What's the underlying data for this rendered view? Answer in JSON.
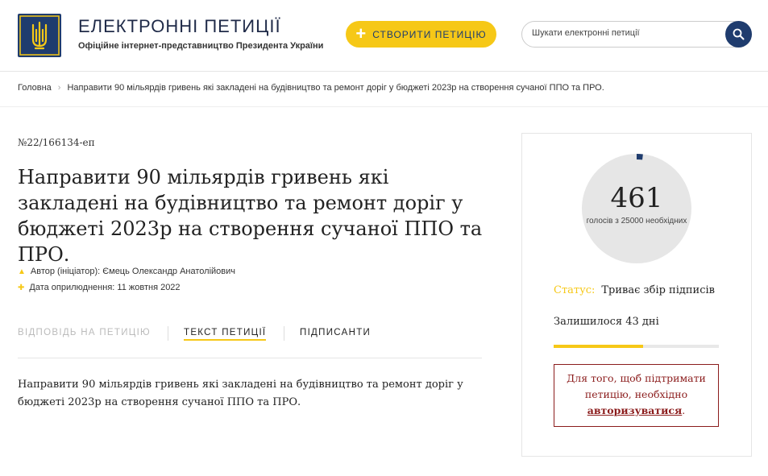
{
  "header": {
    "title": "ЕЛЕКТРОННІ ПЕТИЦІЇ",
    "subtitle": "Офіційне інтернет-представництво Президента України",
    "create_button": "СТВОРИТИ ПЕТИЦІЮ",
    "search_placeholder": "Шукати електронні петиції",
    "logo_icon": "trident-icon",
    "search_icon": "magnifier-icon"
  },
  "breadcrumb": {
    "home": "Головна",
    "current": "Направити 90 мільярдів гривень які закладені на будівництво та ремонт доріг у бюджеті 2023р на створення сучаної ППО та ПРО."
  },
  "petition": {
    "number": "№22/166134-еп",
    "title": "Направити 90 мільярдів гривень які закладені на будівництво та ремонт доріг у бюджеті 2023р на створення сучаної ППО та ПРО.",
    "author": "Автор (ініціатор): Ємець Олександр Анатолійович",
    "date": "Дата оприлюднення: 11 жовтня 2022",
    "body": "Направити 90 мільярдів гривень які закладені на будівництво та ремонт доріг у бюджеті 2023р на створення сучаної ППО та ПРО."
  },
  "tabs": {
    "answer": "ВІДПОВІДЬ НА ПЕТИЦІЮ",
    "text": "ТЕКСТ ПЕТИЦІЇ",
    "signers": "ПІДПИСАНТИ"
  },
  "sidebar": {
    "votes": "461",
    "votes_caption": "голосів з 25000 необхідних",
    "vote_fraction": 0.01844,
    "status_label": "Статус:",
    "status_value": "Триває збір підписів",
    "days_left": "Залишилося 43 дні",
    "time_progress": 0.54,
    "auth_text": "Для того, щоб підтримати петицію, необхідно",
    "auth_link": "авторизуватися",
    "auth_end": "."
  },
  "colors": {
    "brand_blue": "#1f3c6e",
    "accent_yellow": "#f6c817",
    "alert_red": "#8b1c1c",
    "circle_gray": "#e6e6e6"
  }
}
